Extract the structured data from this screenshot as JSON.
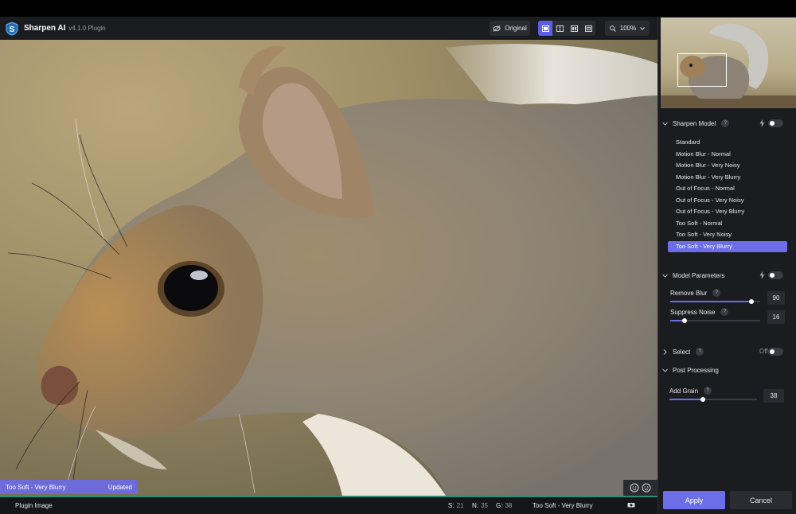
{
  "app": {
    "title": "Sharpen AI",
    "version": "v4.1.0 Plugin"
  },
  "toolbar": {
    "original_label": "Original",
    "zoom": "100%"
  },
  "status": {
    "model": "Too Soft - Very Blurry",
    "state": "Updated"
  },
  "bottombar": {
    "label": "Plugin Image",
    "stats": [
      {
        "key": "S:",
        "value": "21"
      },
      {
        "key": "N:",
        "value": "35"
      },
      {
        "key": "G:",
        "value": "38"
      }
    ],
    "model": "Too Soft - Very Blurry"
  },
  "panel": {
    "sharpen_model": {
      "title": "Sharpen Model",
      "help": "?",
      "items": [
        "Standard",
        "Motion Blur - Normal",
        "Motion Blur - Very Noisy",
        "Motion Blur - Very Blurry",
        "Out of Focus - Normal",
        "Out of Focus - Very Noisy",
        "Out of Focus - Very Blurry",
        "Too Soft - Normal",
        "Too Soft - Very Noisy",
        "Too Soft - Very Blurry"
      ],
      "selected": "Too Soft - Very Blurry"
    },
    "model_parameters": {
      "title": "Model Parameters",
      "remove_blur": {
        "label": "Remove Blur",
        "help": "?",
        "value": "90"
      },
      "suppress_noise": {
        "label": "Suppress Noise",
        "help": "?",
        "value": "16"
      }
    },
    "select": {
      "title": "Select",
      "help": "?",
      "state": "Off"
    },
    "post_processing": {
      "title": "Post Processing",
      "add_grain": {
        "label": "Add Grain",
        "help": "?",
        "value": "38"
      }
    },
    "apply_label": "Apply",
    "cancel_label": "Cancel"
  },
  "colors": {
    "accent": "#6b6ee8",
    "panel_bg": "#1b1c20",
    "status_bar": "#6d6bd8"
  }
}
